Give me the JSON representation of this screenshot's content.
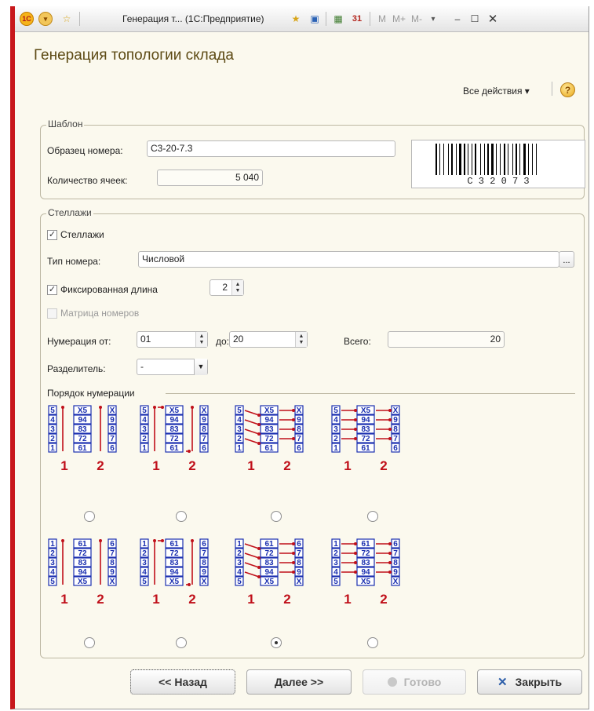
{
  "window": {
    "title": "Генерация т... (1С:Предприятие)",
    "logo_text": "1С",
    "m_buttons": [
      "M",
      "M+",
      "M-"
    ]
  },
  "form": {
    "title": "Генерация топологии склада",
    "all_actions": "Все действия ▾",
    "help": "?"
  },
  "template_group": {
    "title": "Шаблон",
    "number_sample_label": "Образец номера:",
    "number_sample_value": "С3-20-7.3",
    "cell_count_label": "Количество ячеек:",
    "cell_count_value": "5 040",
    "barcode_text": "C 3 2 0 7 3"
  },
  "racks_group": {
    "title": "Стеллажи",
    "racks_checkbox_label": "Стеллажи",
    "racks_checked": true,
    "number_type_label": "Тип номера:",
    "number_type_value": "Числовой",
    "fixed_length_label": "Фиксированная длина",
    "fixed_length_checked": true,
    "fixed_length_value": "2",
    "matrix_label": "Матрица номеров",
    "numbering_from_label": "Нумерация от:",
    "numbering_from_value": "01",
    "numbering_to_label": "до:",
    "numbering_to_value": "20",
    "total_label": "Всего:",
    "total_value": "20",
    "separator_label": "Разделитель:",
    "separator_value": "-",
    "order_title": "Порядок нумерации",
    "selected_order_index": 6,
    "rack_labels": [
      "1",
      "2"
    ]
  },
  "buttons": {
    "back": "<< Назад",
    "next": "Далее >>",
    "done": "Готово",
    "close": "Закрыть"
  },
  "colors": {
    "accent_red": "#c8181c",
    "title_brown": "#5d4a14",
    "cell_blue": "#1a2fb0",
    "arrow_red": "#c0101a"
  }
}
